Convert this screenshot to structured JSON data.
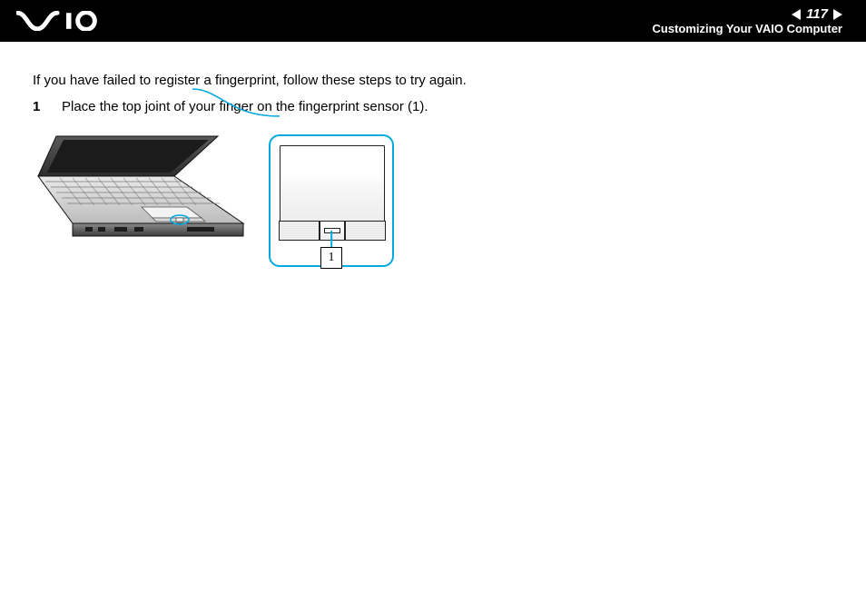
{
  "header": {
    "page_number": "117",
    "section_title": "Customizing Your VAIO Computer",
    "logo_text": "VAIO"
  },
  "body": {
    "intro": "If you have failed to register a fingerprint, follow these steps to try again.",
    "steps": [
      {
        "num": "1",
        "text": "Place the top joint of your finger on the fingerprint sensor (1)."
      }
    ],
    "figure": {
      "callout_label": "1"
    }
  }
}
